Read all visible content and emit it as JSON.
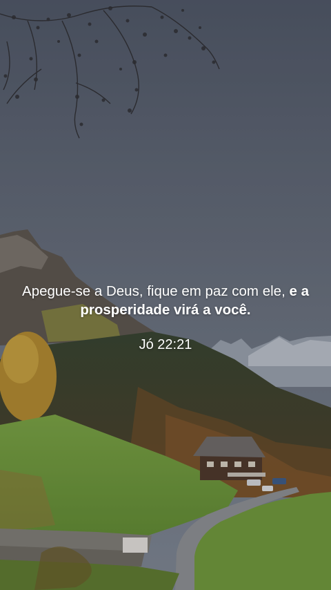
{
  "verse": {
    "text_regular": "Apegue-se a Deus, fique em paz com ele, ",
    "text_bold": "e a prosperidade virá a você.",
    "reference": "Jó 22:21"
  },
  "colors": {
    "sky_top": "#4e5666",
    "sky_bottom": "#7d8591",
    "grass": "#6f9a3a",
    "forest": "#2f3b23",
    "autumn": "#b8862e",
    "text": "#ffffff"
  },
  "icons": {
    "scene": "mountain-landscape-background"
  }
}
